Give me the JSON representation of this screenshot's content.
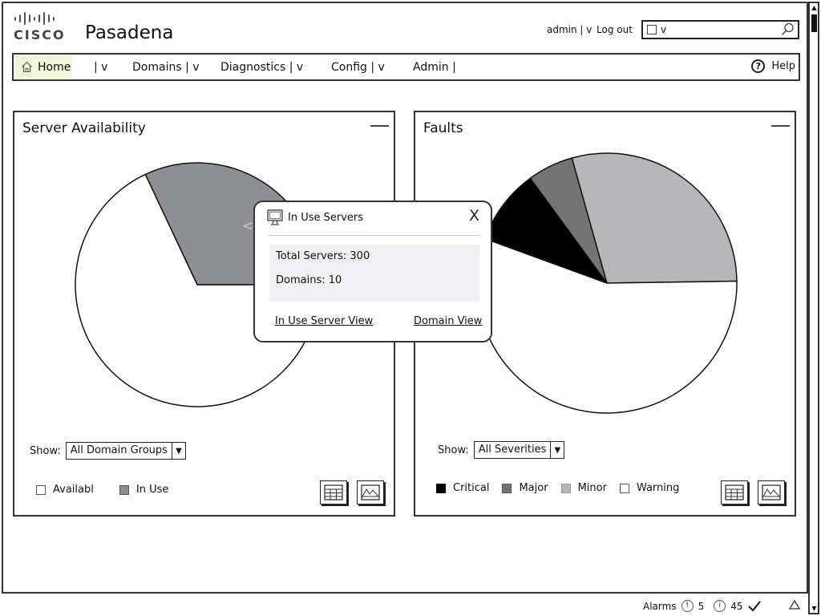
{
  "header": {
    "logo_text": "CISCO",
    "app_title": "Pasadena",
    "user_menu": "admin | v",
    "logout": "Log out",
    "search": {
      "value": "v",
      "icon": "search-icon"
    }
  },
  "nav": {
    "home": "Home",
    "items": [
      "| v",
      "Domains | v",
      "Diagnostics | v",
      "Config | v",
      "Admin |"
    ],
    "help": "Help"
  },
  "panels": {
    "server": {
      "title": "Server Availability",
      "show_label": "Show:",
      "select_value": "All Domain Groups",
      "legend": [
        {
          "label": "Availabl",
          "color": "#ffffff"
        },
        {
          "label": "In Use",
          "color": "#8e8f92"
        }
      ]
    },
    "faults": {
      "title": "Faults",
      "show_label": "Show:",
      "select_value": "All Severities",
      "legend": [
        {
          "label": "Critical",
          "color": "#000000"
        },
        {
          "label": "Major",
          "color": "#747474"
        },
        {
          "label": "Minor",
          "color": "#b7b7b9"
        },
        {
          "label": "Warning",
          "color": "#ffffff"
        }
      ]
    }
  },
  "popup": {
    "title": "In Use Servers",
    "close": "X",
    "rows": [
      "Total Servers: 300",
      "Domains: 10"
    ],
    "links": [
      "In Use Server View",
      "Domain View"
    ]
  },
  "status": {
    "alarms_label": "Alarms",
    "critical_count": "5",
    "info_count": "45"
  },
  "chart_data": [
    {
      "type": "pie",
      "title": "Server Availability",
      "categories": [
        "Available",
        "In Use"
      ],
      "values": [
        68,
        32
      ],
      "colors": [
        "#ffffff",
        "#8e8f92"
      ],
      "legend": "bottom-left"
    },
    {
      "type": "pie",
      "title": "Faults",
      "categories": [
        "Critical",
        "Major",
        "Minor",
        "Warning"
      ],
      "values": [
        9.4,
        5.7,
        29.1,
        55.8
      ],
      "colors": [
        "#000000",
        "#747474",
        "#b7b7b9",
        "#ffffff"
      ],
      "legend": "bottom-left"
    }
  ]
}
